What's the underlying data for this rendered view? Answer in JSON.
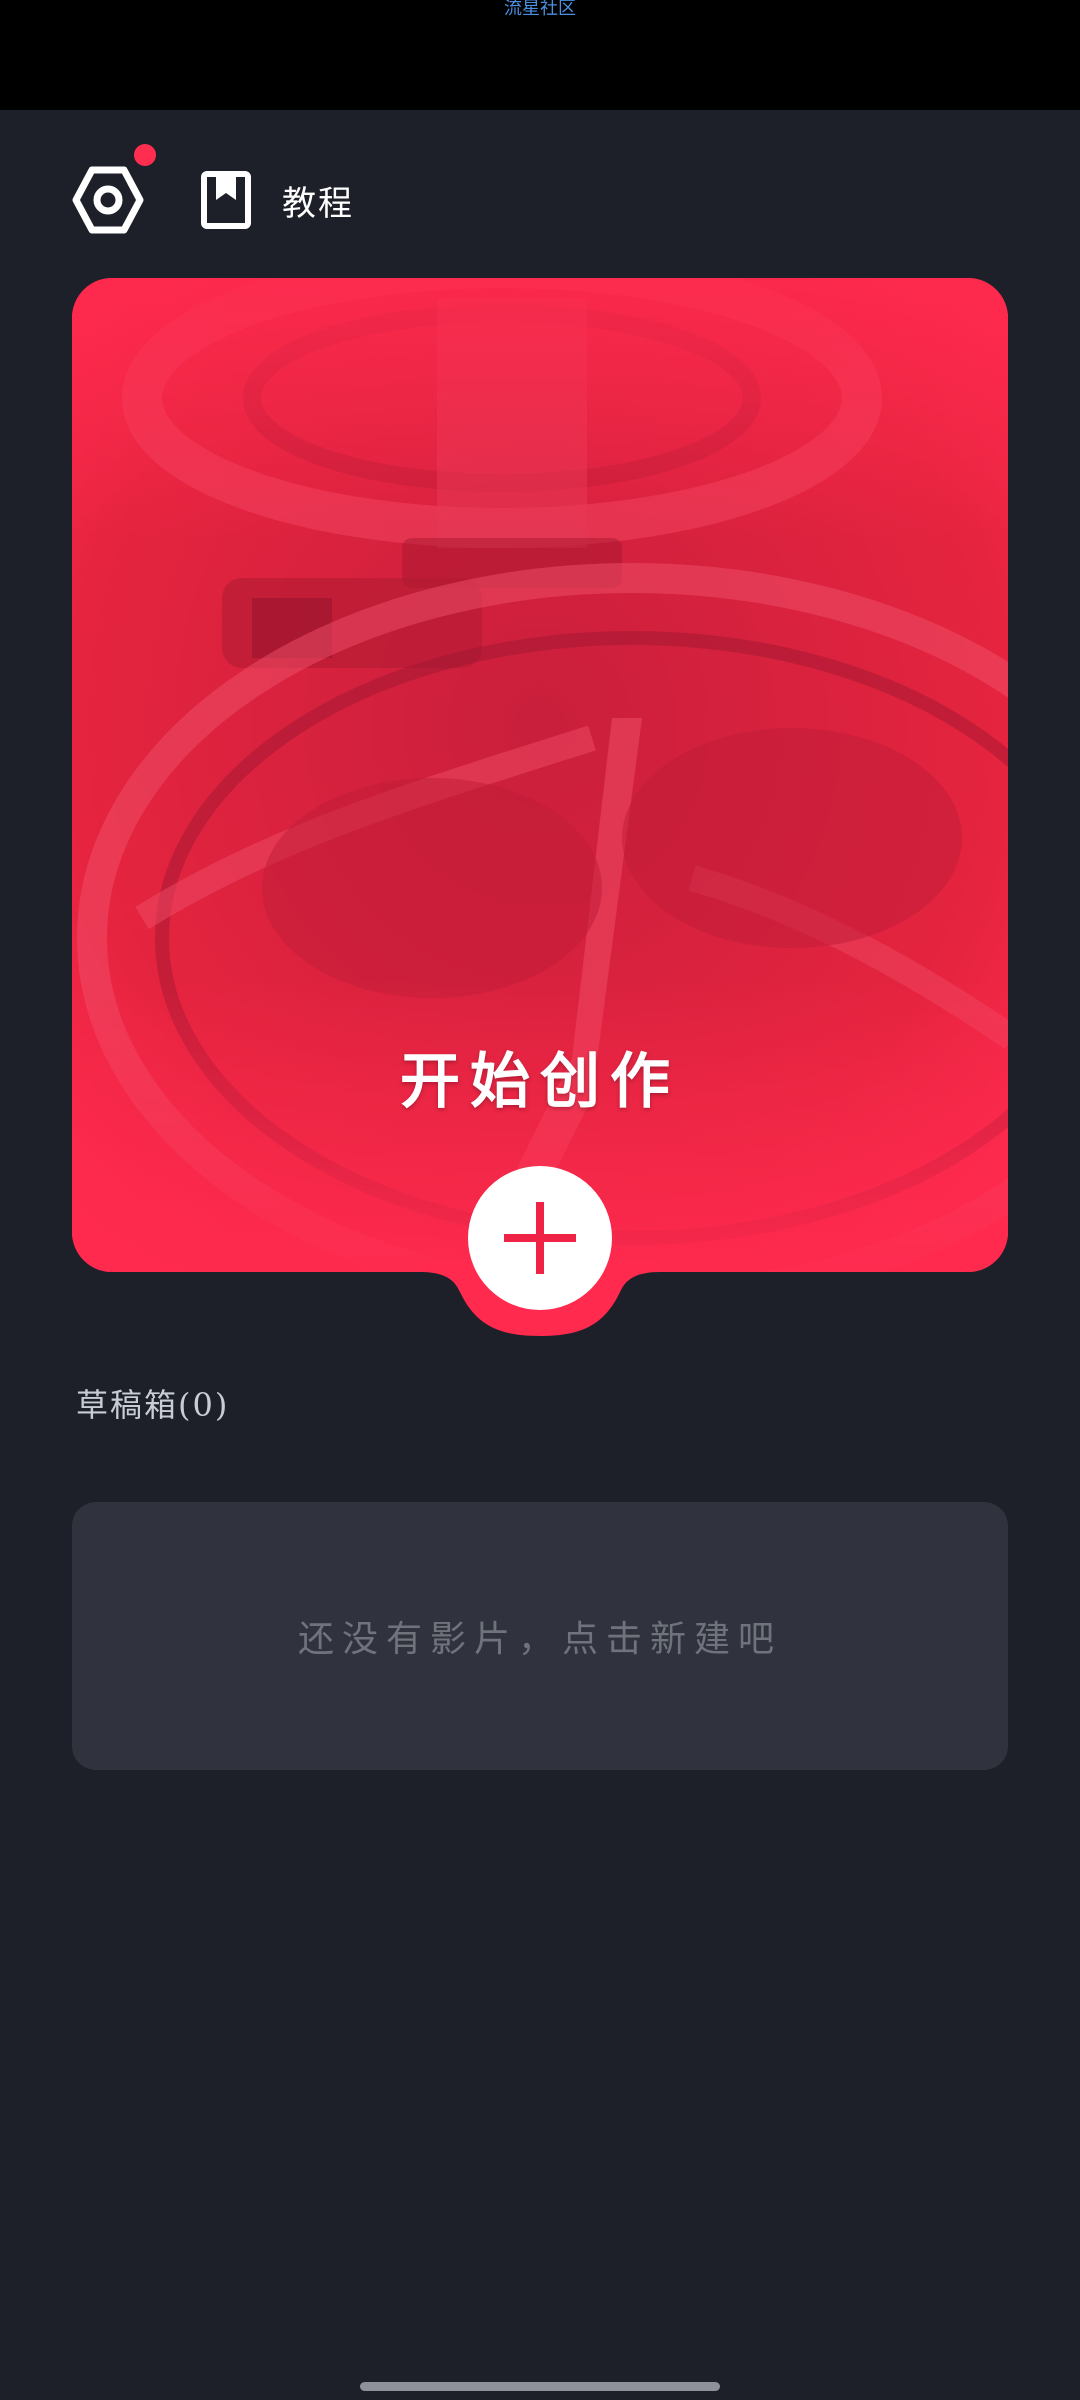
{
  "status_bar": {
    "text": "流星社区"
  },
  "header": {
    "settings_icon": "gear-icon",
    "notification_color": "#ff2d4f",
    "tutorial_icon": "bookmark-book-icon",
    "tutorial_label": "教程"
  },
  "create_card": {
    "title": "开始创作",
    "accent": "#ff2a4e",
    "plus_icon": "plus-icon"
  },
  "drafts": {
    "title": "草稿箱(0)",
    "empty_text": "还没有影片，点击新建吧"
  }
}
